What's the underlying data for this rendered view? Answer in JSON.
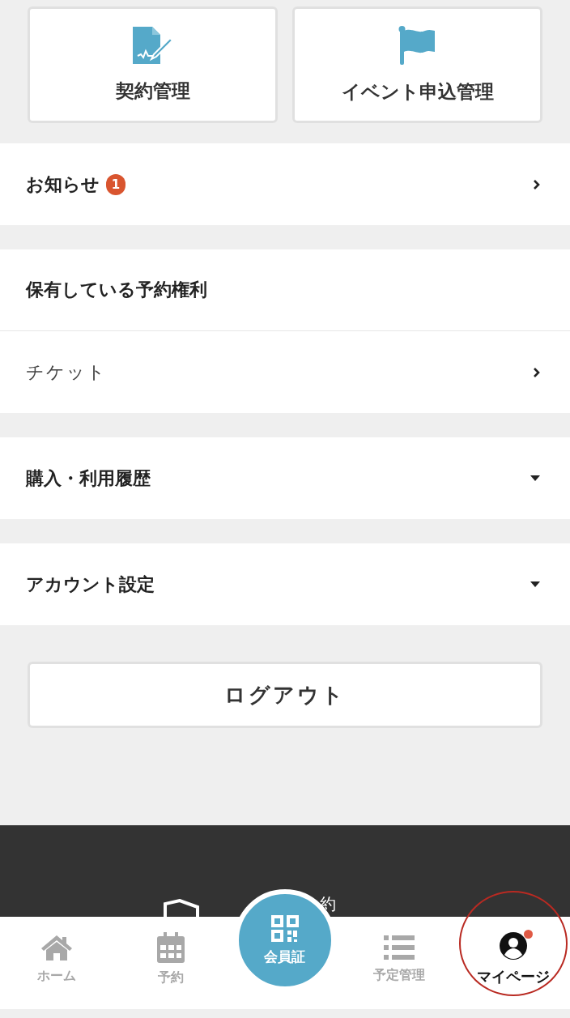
{
  "shortcuts": [
    {
      "label": "契約管理"
    },
    {
      "label": "イベント申込管理"
    }
  ],
  "sections": [
    {
      "rows": [
        {
          "kind": "link",
          "label": "お知らせ",
          "badge": "1",
          "bold": true
        }
      ]
    },
    {
      "title": "保有している予約権利",
      "rows": [
        {
          "kind": "link",
          "label": "チケット",
          "bold": false
        }
      ]
    },
    {
      "rows": [
        {
          "kind": "collapsible",
          "label": "購入・利用履歴",
          "bold": true,
          "expanded": false
        }
      ]
    },
    {
      "rows": [
        {
          "kind": "collapsible",
          "label": "アカウント設定",
          "bold": true,
          "expanded": false
        }
      ]
    }
  ],
  "logout_button": "ログアウト",
  "footer": {
    "text_fragment": "約"
  },
  "bottom_nav": [
    {
      "kind": "tab",
      "label": "ホーム",
      "selected": false,
      "notification": false
    },
    {
      "kind": "tab",
      "label": "予約",
      "selected": false,
      "notification": false
    },
    {
      "kind": "center",
      "label": "会員証"
    },
    {
      "kind": "tab",
      "label": "予定管理",
      "selected": false,
      "notification": false
    },
    {
      "kind": "tab",
      "label": "マイページ",
      "selected": true,
      "notification": true
    }
  ]
}
